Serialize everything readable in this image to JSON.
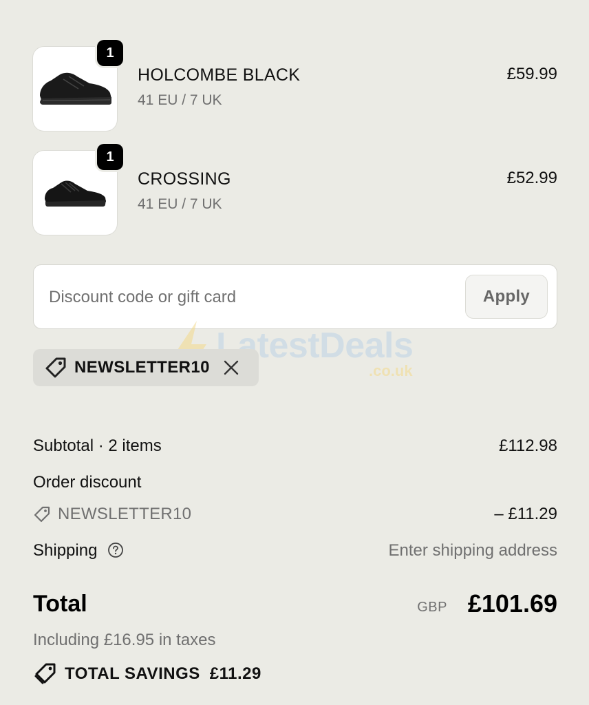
{
  "line_items": [
    {
      "quantity": "1",
      "name": "HOLCOMBE BLACK",
      "variant": "41 EU / 7 UK",
      "price": "£59.99",
      "image_icon": "black-leather-sneaker-image"
    },
    {
      "quantity": "1",
      "name": "CROSSING",
      "variant": "41 EU / 7 UK",
      "price": "£52.99",
      "image_icon": "black-mesh-sneaker-image"
    }
  ],
  "discount": {
    "placeholder": "Discount code or gift card",
    "value": "",
    "apply_label": "Apply"
  },
  "applied_code": {
    "code": "NEWSLETTER10",
    "tag_icon": "tag-icon",
    "remove_icon": "close-icon"
  },
  "watermark": {
    "brand": "LatestDeals",
    "suffix": ".co.uk"
  },
  "summary": {
    "subtotal_label": "Subtotal · 2 items",
    "subtotal_value": "£112.98",
    "order_discount_label": "Order discount",
    "discount_code": "NEWSLETTER10",
    "discount_value": "– £11.29",
    "shipping_label": "Shipping",
    "shipping_value": "Enter shipping address",
    "total_label": "Total",
    "currency": "GBP",
    "total_value": "£101.69",
    "taxes_note": "Including £16.95 in taxes",
    "savings_label": "TOTAL SAVINGS",
    "savings_value": "£11.29"
  },
  "colors": {
    "background": "#ebebe5",
    "text": "#111111",
    "muted": "#707070",
    "badge": "#000000",
    "chip": "#dcdcd7"
  }
}
